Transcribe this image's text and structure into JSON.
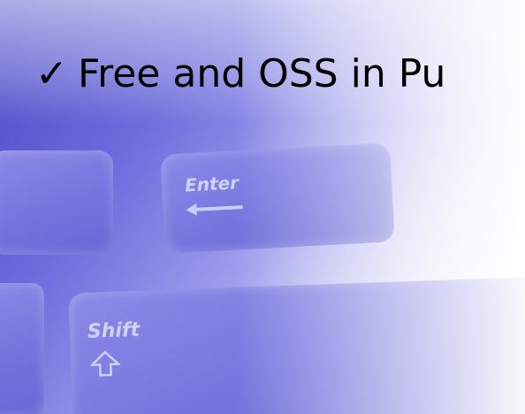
{
  "slide": {
    "bullet_marker": "✓",
    "bullet_text": "Free and OSS in Pu"
  },
  "keyboard_image": {
    "enter_key_label": "Enter",
    "shift_key_label": "Shift",
    "key_tint": "#7574de"
  },
  "colors": {
    "background_blue": "#4a49c8",
    "text": "#000000"
  }
}
